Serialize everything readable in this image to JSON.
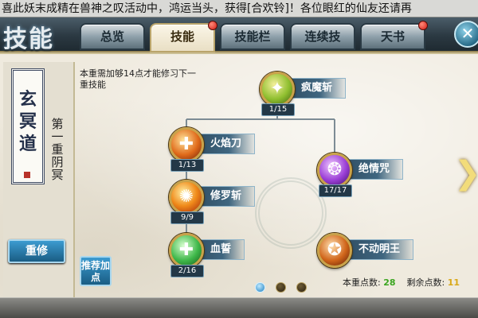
{
  "ticker": {
    "text": "喜此妖末成精在兽神之叹活动中，鸿运当头，获得[合欢铃]！各位眼红的仙友还请再"
  },
  "header": {
    "title": "技能",
    "tabs": [
      {
        "label": "总览",
        "active": false,
        "badge": false
      },
      {
        "label": "技能",
        "active": true,
        "badge": true
      },
      {
        "label": "技能栏",
        "active": false,
        "badge": false
      },
      {
        "label": "连续技",
        "active": false,
        "badge": false
      },
      {
        "label": "天书",
        "active": false,
        "badge": true
      }
    ],
    "close_icon": "✕"
  },
  "sidebar": {
    "scroll_chars": [
      "玄",
      "冥",
      "道"
    ],
    "realm_label": [
      "第",
      "一",
      "重",
      "阴",
      "冥"
    ],
    "reset_button": "重修"
  },
  "main": {
    "requirement_note": "本重需加够14点才能修习下一重技能",
    "recommend_button": "推荐加点",
    "skills": [
      {
        "name": "疯魔斩",
        "level": "1/15",
        "icon": "madness-slash-icon",
        "glyph": "✦"
      },
      {
        "name": "火焰刀",
        "level": "1/13",
        "icon": "flame-blade-icon",
        "glyph": "✚"
      },
      {
        "name": "绝情咒",
        "level": "17/17",
        "icon": "heartless-curse-icon",
        "glyph": "❂"
      },
      {
        "name": "修罗斩",
        "level": "9/9",
        "icon": "asura-slash-icon",
        "glyph": "✺"
      },
      {
        "name": "血誓",
        "level": "2/16",
        "icon": "blood-oath-icon",
        "glyph": "✚"
      },
      {
        "name": "不动明王",
        "level": "",
        "icon": "immovable-king-icon",
        "glyph": "✪"
      }
    ],
    "next_arrow": "❯"
  },
  "footer": {
    "current_points_label": "本重点数:",
    "current_points_value": "28",
    "remaining_points_label": "剩余点数:",
    "remaining_points_value": "11",
    "pager": {
      "pages": 3,
      "active": 0
    }
  },
  "colors": {
    "parchment": "#efeade",
    "tab_active": "#fbf6e8",
    "accent_blue": "#2e6f95",
    "points_green": "#3aa51f",
    "points_yellow": "#d8a817"
  }
}
